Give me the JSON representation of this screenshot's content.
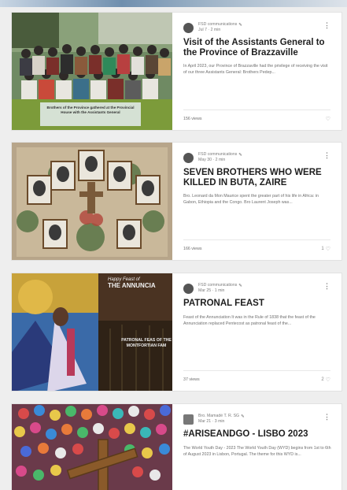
{
  "posts": [
    {
      "author": "FSD communications",
      "date_read": "Jul 7 · 2 min",
      "title": "Visit of the Assistants General to the Province of Brazzaville",
      "excerpt": "In April 2023, our Province of Brazzaville had the privilege of receiving the visit of our three Assistants General: Brothers Pedep...",
      "views": "156 views",
      "likes": "",
      "image_caption": "Brothers of the Province gathered at the Provincial House with the Assistants General",
      "title_color": "#1e1e1e"
    },
    {
      "author": "FSD communications",
      "date_read": "May 30 · 2 min",
      "title": "SEVEN BROTHERS WHO WERE KILLED IN BUTA, ZAIRE",
      "excerpt": "Bro. Leonard da Mon Maurice spent the greater part of his life in Africa: in Gabon, Ethiopia and the Congo. Bro Laurent Joseph was...",
      "views": "166 views",
      "likes": "1"
    },
    {
      "author": "FSD communications",
      "date_read": "Mar 25 · 1 min",
      "title": "PATRONAL FEAST",
      "excerpt": "Feast of the Annunciation It was in the Rule of 1838 that the feast of the Annunciation replaced Pentecost as patronal feast of the...",
      "views": "37 views",
      "likes": "2",
      "poster_line1": "Happy Feast of",
      "poster_line2": "THE ANNUNCIA",
      "poster_sub": "PATRONAL FEAS OF THE MONTFORTIAN FAM"
    },
    {
      "author": "Bro. Mamadé T. R. SG",
      "date_read": "Mar 21 · 3 min",
      "title": "#ARISEANDGO - LISBO 2023",
      "excerpt": "The World Youth Day - 2023 The World Youth Day (WYD) begins from 1st to 6th of August 2023 in Lisbon, Portugal. The theme for this WYD is..."
    }
  ],
  "icons": {
    "more": "⋮",
    "heart": "♡",
    "edit": "✎",
    "avatar_placeholder": "●"
  },
  "colors": {
    "card_bg": "#ffffff",
    "page_bg": "#eeeeee",
    "text_primary": "#1e1e1e",
    "text_secondary": "#6f6f6f"
  }
}
